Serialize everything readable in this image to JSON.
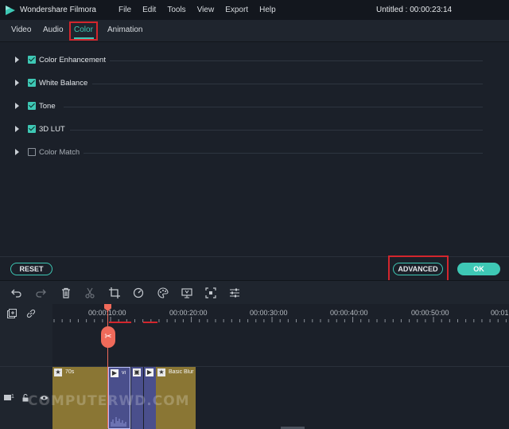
{
  "titlebar": {
    "app_name": "Wondershare Filmora",
    "menu": [
      "File",
      "Edit",
      "Tools",
      "View",
      "Export",
      "Help"
    ],
    "document_title": "Untitled : 00:00:23:14"
  },
  "tabs": {
    "video": "Video",
    "audio": "Audio",
    "color": "Color",
    "animation": "Animation",
    "active": "Color"
  },
  "color_sections": [
    {
      "label": "Color Enhancement",
      "checked": true
    },
    {
      "label": "White Balance",
      "checked": true
    },
    {
      "label": "Tone",
      "checked": true
    },
    {
      "label": "3D LUT",
      "checked": true
    },
    {
      "label": "Color Match",
      "checked": false
    }
  ],
  "buttons": {
    "reset": "RESET",
    "advanced": "ADVANCED",
    "ok": "OK"
  },
  "toolbar_icons": [
    "undo-icon",
    "redo-icon",
    "delete-icon",
    "cut-icon",
    "crop-icon",
    "speed-icon",
    "color-icon",
    "green-screen-icon",
    "fit-icon",
    "audio-mixer-icon"
  ],
  "ruler": {
    "labels": [
      "00:00:10:00",
      "00:00:20:00",
      "00:00:30:00",
      "00:00:40:00",
      "00:00:50:00",
      "00:01"
    ]
  },
  "track": {
    "number": "1",
    "clips": [
      {
        "name": "70s",
        "type": "effect"
      },
      {
        "name": "vi",
        "type": "video"
      },
      {
        "name": "",
        "type": "image"
      },
      {
        "name": "",
        "type": "video"
      },
      {
        "name": "Basic Blur",
        "type": "effect"
      }
    ]
  },
  "watermark": "COMPUTERWD.COM",
  "colors": {
    "accent": "#3ec8b5",
    "highlight_box": "#d3262d",
    "playhead": "#f06a5a",
    "effect_clip": "#8a7634",
    "video_clip": "#4a4f8c"
  }
}
